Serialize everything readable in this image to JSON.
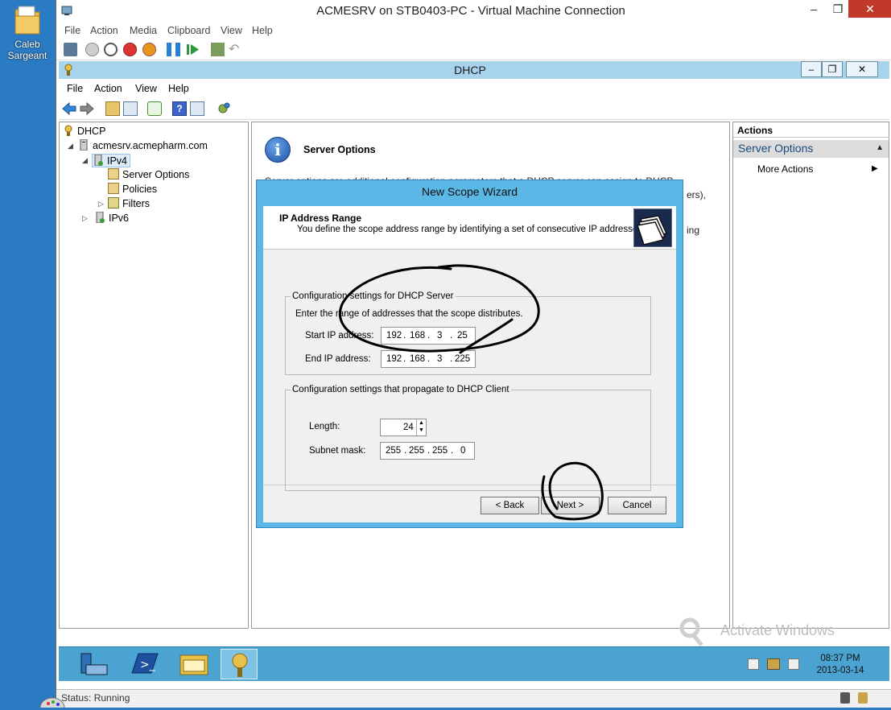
{
  "desktop": {
    "icon_label_line1": "Caleb",
    "icon_label_line2": "Sargeant"
  },
  "vm": {
    "title": "ACMESRV on STB0403-PC - Virtual Machine Connection",
    "menu": [
      "File",
      "Action",
      "Media",
      "Clipboard",
      "View",
      "Help"
    ],
    "status": "Status: Running"
  },
  "dhcp": {
    "title": "DHCP",
    "menu": [
      "File",
      "Action",
      "View",
      "Help"
    ],
    "tree": {
      "root": "DHCP",
      "server": "acmesrv.acmepharm.com",
      "ipv4": "IPv4",
      "server_options": "Server Options",
      "policies": "Policies",
      "filters": "Filters",
      "ipv6": "IPv6"
    },
    "center": {
      "heading": "Server Options",
      "desc_left": "Server options are additional configuration parameters that a DHCP server can assign to DHCP",
      "desc_right_1": "ers),",
      "desc_right_2": "ing"
    },
    "actions": {
      "header": "Actions",
      "section": "Server Options",
      "more": "More Actions"
    }
  },
  "wizard": {
    "title": "New Scope Wizard",
    "heading": "IP Address Range",
    "subheading": "You define the scope address range by identifying a set of consecutive IP addresses.",
    "group1": {
      "legend": "Configuration settings for DHCP Server",
      "instruction": "Enter the range of addresses that the scope distributes.",
      "start_label": "Start IP address:",
      "start_ip": [
        "192",
        "168",
        "3",
        "25"
      ],
      "end_label": "End IP address:",
      "end_ip": [
        "192",
        "168",
        "3",
        "225"
      ]
    },
    "group2": {
      "legend": "Configuration settings that propagate to DHCP Client",
      "length_label": "Length:",
      "length_value": "24",
      "mask_label": "Subnet mask:",
      "mask": [
        "255",
        "255",
        "255",
        "0"
      ]
    },
    "buttons": {
      "back": "< Back",
      "next": "Next >",
      "cancel": "Cancel"
    }
  },
  "guest_taskbar": {
    "watermark_title": "Activate Windows",
    "time": "08:37 PM",
    "date": "2013-03-14"
  },
  "colors": {
    "accent": "#5bb8e6",
    "taskbar": "#4aa3d1",
    "titlebar": "#a7d3ec"
  }
}
